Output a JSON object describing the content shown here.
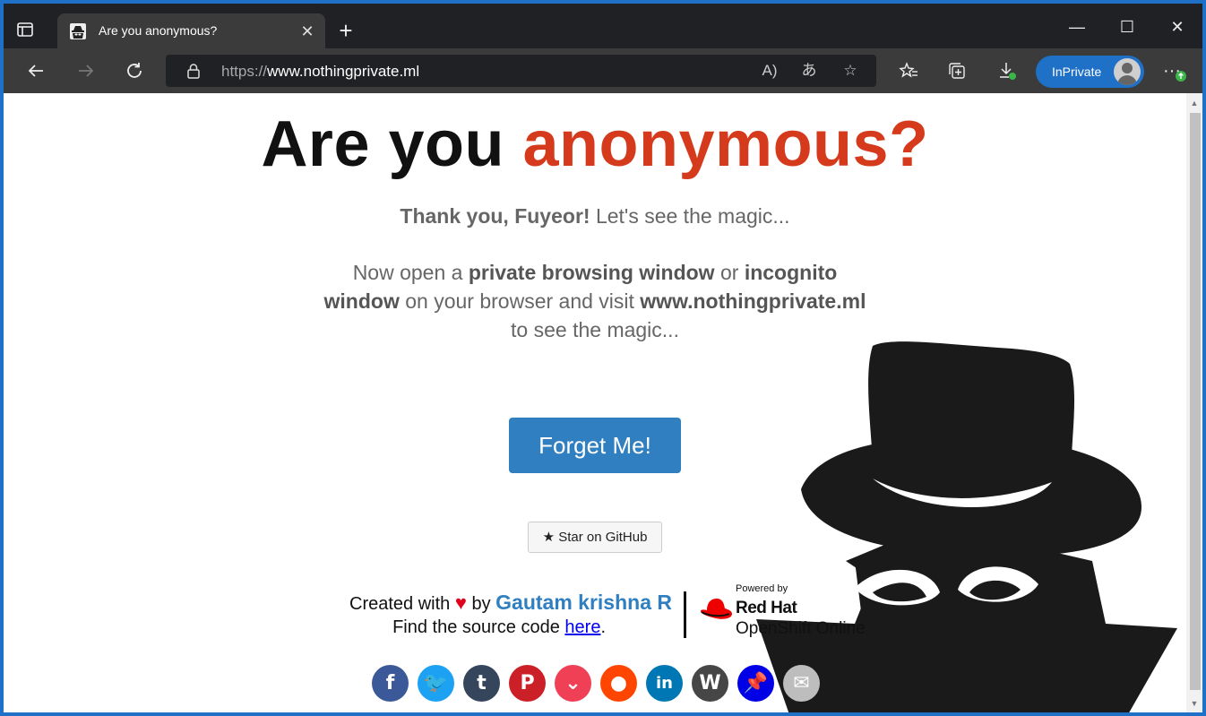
{
  "browser": {
    "tab_title": "Are you anonymous?",
    "tab_close": "✕",
    "new_tab": "+",
    "url_scheme": "https://",
    "url_host": "www.nothingprivate.ml",
    "inprivate_label": "InPrivate",
    "window_controls": {
      "minimize": "—",
      "maximize": "☐",
      "close": "✕"
    },
    "more": "···"
  },
  "page": {
    "headline_part1": "Are you ",
    "headline_part2": "anonymous?",
    "thanks_bold": "Thank you, Fuyeor!",
    "thanks_rest": " Let's see the magic...",
    "instr_1": "Now open a ",
    "instr_2": "private browsing window",
    "instr_3": " or ",
    "instr_4": "incognito window",
    "instr_5": " on your browser and visit ",
    "instr_6": "www.nothingprivate.ml",
    "instr_7": " to see the magic...",
    "forget_button": "Forget Me!",
    "github_button": "Star on GitHub",
    "created_with": "Created with ",
    "heart": "♥",
    "by": " by ",
    "author": "Gautam krishna R",
    "find_source": "Find the source code ",
    "here_link": "here",
    "period": ".",
    "powered_by": "Powered by",
    "redhat": "Red Hat",
    "openshift": "OpenShift Online"
  },
  "social": [
    {
      "name": "facebook",
      "glyph": "f",
      "color": "#3b5998"
    },
    {
      "name": "twitter",
      "glyph": "🐦",
      "color": "#1da1f2"
    },
    {
      "name": "tumblr",
      "glyph": "t",
      "color": "#35465c"
    },
    {
      "name": "pinterest",
      "glyph": "P",
      "color": "#cb2027"
    },
    {
      "name": "pocket",
      "glyph": "⌄",
      "color": "#ef4056"
    },
    {
      "name": "reddit",
      "glyph": "●",
      "color": "#ff4500"
    },
    {
      "name": "linkedin",
      "glyph": "in",
      "color": "#0077b5"
    },
    {
      "name": "wordpress",
      "glyph": "W",
      "color": "#464646"
    },
    {
      "name": "pinboard",
      "glyph": "📌",
      "color": "#0000e6"
    },
    {
      "name": "email",
      "glyph": "✉",
      "color": "#bdbdbd"
    }
  ]
}
